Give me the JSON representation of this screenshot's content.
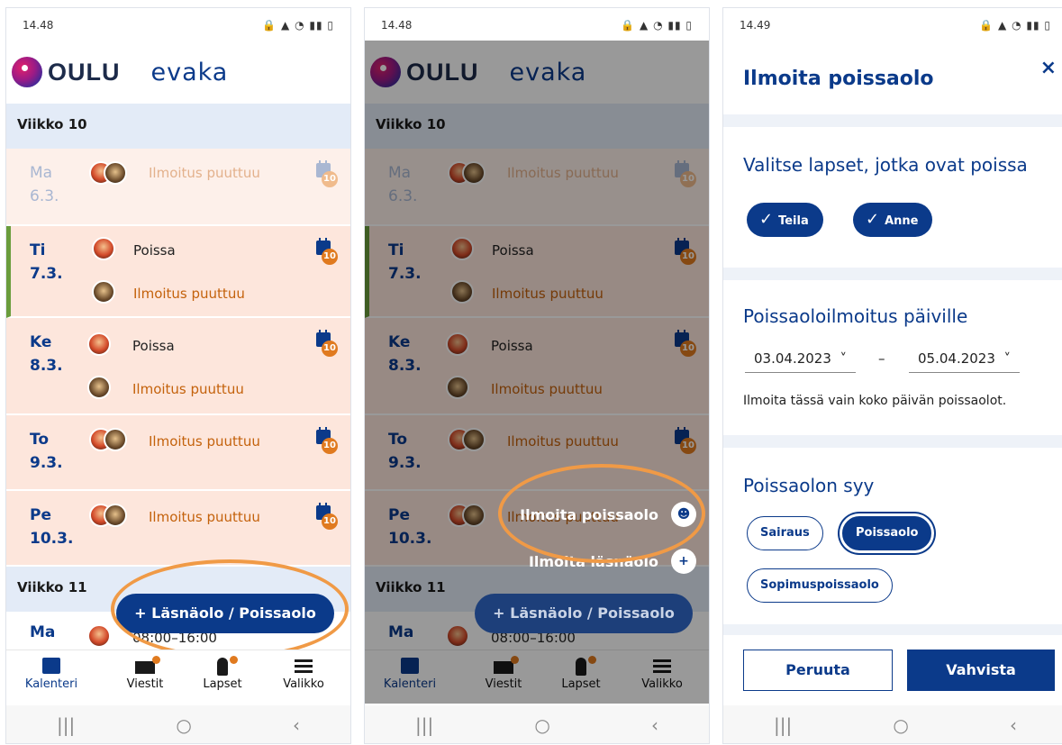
{
  "colors": {
    "primary": "#0b3a8a",
    "warning": "#c4620c",
    "highlight": "#f09a46",
    "absent_bg": "#fde6dc"
  },
  "screen1": {
    "status_time": "14.48",
    "status_icons": "🔒 ▲ ◔ ▮▮ ▯",
    "logo": "OULU",
    "app": "evaka",
    "week10": "Viikko 10",
    "week11": "Viikko 11",
    "days": [
      {
        "name": "Ma",
        "date": "6.3.",
        "line1": "Ilmoitus puuttuu",
        "badge": "10"
      },
      {
        "name": "Ti",
        "date": "7.3.",
        "line1": "Poissa",
        "line2": "Ilmoitus puuttuu",
        "badge": "10"
      },
      {
        "name": "Ke",
        "date": "8.3.",
        "line1": "Poissa",
        "line2": "Ilmoitus puuttuu",
        "badge": "10"
      },
      {
        "name": "To",
        "date": "9.3.",
        "line1": "Ilmoitus puuttuu",
        "badge": "10"
      },
      {
        "name": "Pe",
        "date": "10.3.",
        "line1": "Ilmoitus puuttuu",
        "badge": "10"
      },
      {
        "name": "Ma",
        "time": "08:00–16:00"
      }
    ],
    "fab": "+ Läsnäolo / Poissaolo",
    "nav": {
      "calendar": "Kalenteri",
      "messages": "Viestit",
      "children": "Lapset",
      "menu": "Valikko"
    },
    "sys": {
      "recent": "|||",
      "home": "○",
      "back": "‹"
    }
  },
  "screen2": {
    "status_time": "14.48",
    "menu_absence": "Ilmoita poissaolo",
    "menu_presence": "Ilmoita läsnäolo",
    "menu_absence_icon": "person-minus-icon",
    "menu_presence_icon": "calendar-plus-icon"
  },
  "screen3": {
    "status_time": "14.49",
    "title": "Ilmoita poissaolo",
    "close": "×",
    "children_label": "Valitse lapset, jotka ovat poissa",
    "children": [
      "Teila",
      "Anne"
    ],
    "dates_label": "Poissaoloilmoitus päiville",
    "date_start": "03.04.2023",
    "date_end": "05.04.2023",
    "date_dash": "–",
    "date_hint": "Ilmoita tässä vain koko päivän poissaolot.",
    "reason_label": "Poissaolon syy",
    "reasons": [
      "Sairaus",
      "Poissaolo",
      "Sopimuspoissaolo"
    ],
    "selected_reason": "Poissaolo",
    "cancel": "Peruuta",
    "confirm": "Vahvista"
  }
}
